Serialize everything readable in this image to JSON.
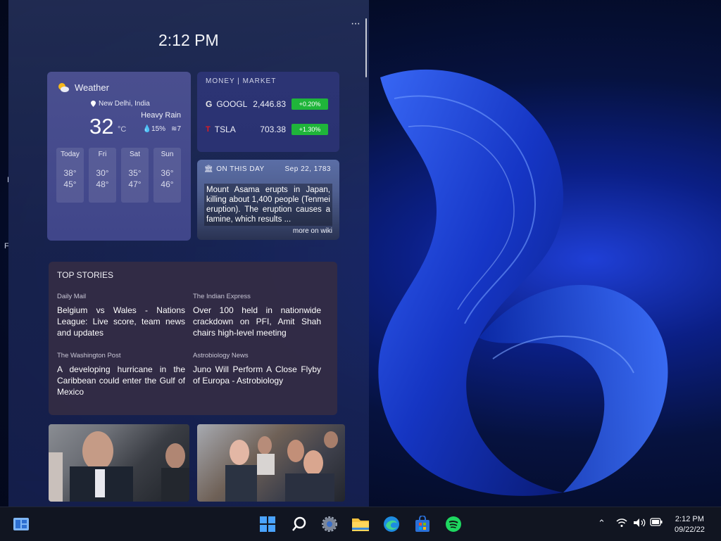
{
  "desktop": {
    "letters": [
      "I",
      "F"
    ]
  },
  "pane": {
    "clock": "2:12 PM",
    "more_icon": "···"
  },
  "weather": {
    "title": "Weather",
    "location": "New Delhi, India",
    "temp": "32",
    "unit": "°C",
    "condition": "Heavy Rain",
    "precip": "15%",
    "wind": "7",
    "days": [
      {
        "name": "Today",
        "hi": "38°",
        "lo": "45°"
      },
      {
        "name": "Fri",
        "hi": "30°",
        "lo": "48°"
      },
      {
        "name": "Sat",
        "hi": "35°",
        "lo": "47°"
      },
      {
        "name": "Sun",
        "hi": "36°",
        "lo": "46°"
      }
    ]
  },
  "money": {
    "header": "MONEY | MARKET",
    "stocks": [
      {
        "symbol": "GOOGL",
        "price": "2,446.83",
        "change": "+0.20%",
        "color": "#1fb53a"
      },
      {
        "symbol": "TSLA",
        "price": "703.38",
        "change": "+1.30%",
        "color": "#1fb53a"
      }
    ]
  },
  "onthisday": {
    "header": "ON THIS DAY",
    "date": "Sep 22, 1783",
    "text": "Mount Asama erupts in Japan, killing about 1,400 people (Tenmei eruption). The eruption causes a famine, which results ...",
    "more": "more on wiki"
  },
  "top_stories": {
    "title": "TOP STORIES",
    "items": [
      {
        "source": "Daily Mail",
        "headline": "Belgium vs Wales - Nations League: Live score, team news and updates"
      },
      {
        "source": "The Indian Express",
        "headline": "Over 100 held in nationwide crackdown on PFI, Amit Shah chairs high-level meeting"
      },
      {
        "source": "The Washington Post",
        "headline": "A developing hurricane in the Caribbean could enter the Gulf of Mexico"
      },
      {
        "source": "Astrobiology News",
        "headline": "Juno Will Perform A Close Flyby of Europa - Astrobiology"
      }
    ]
  },
  "taskbar": {
    "icons": [
      "widgets-icon",
      "start-icon",
      "search-icon",
      "settings-icon",
      "file-explorer-icon",
      "edge-icon",
      "store-icon",
      "spotify-icon"
    ],
    "time": "2:12 PM",
    "date": "09/22/22"
  },
  "colors": {
    "accent_green": "#1fb53a",
    "tesla_red": "#e01b22",
    "taskbar": "#111521"
  }
}
